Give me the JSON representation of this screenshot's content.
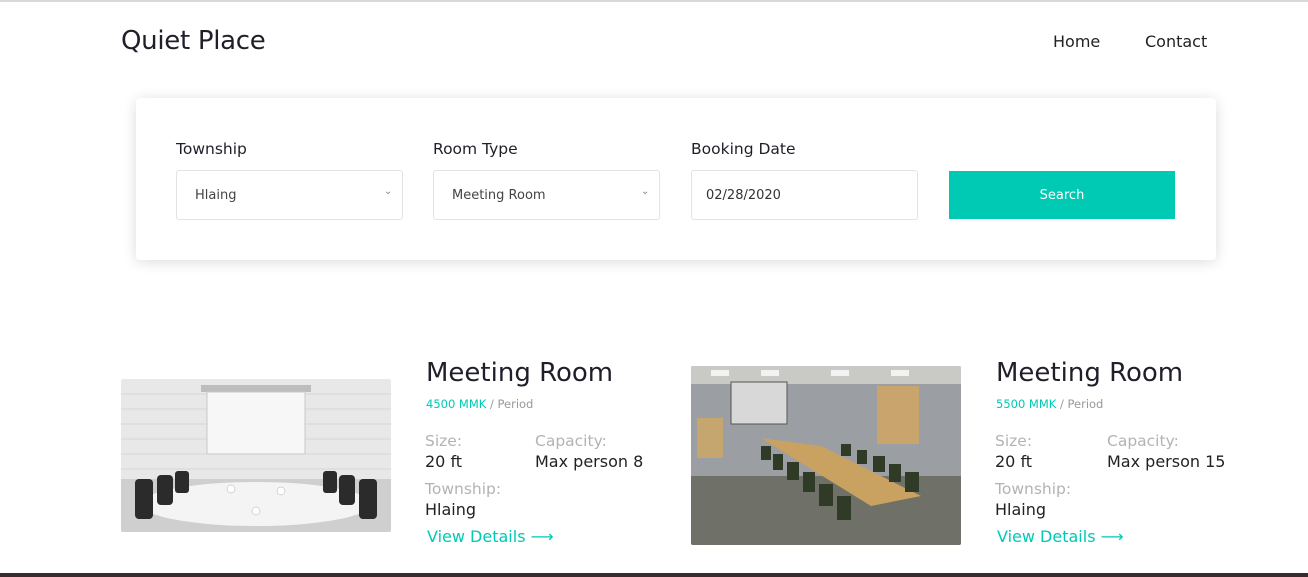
{
  "header": {
    "brand": "Quiet Place",
    "nav": [
      {
        "label": "Home"
      },
      {
        "label": "Contact"
      }
    ]
  },
  "search": {
    "township": {
      "label": "Township",
      "value": "Hlaing"
    },
    "room_type": {
      "label": "Room Type",
      "value": "Meeting Room"
    },
    "booking_date": {
      "label": "Booking Date",
      "value": "02/28/2020"
    },
    "button_label": "Search"
  },
  "rooms": [
    {
      "title": "Meeting Room",
      "price": "4500 MMK",
      "period": "/ Period",
      "size_label": "Size:",
      "size": "20 ft",
      "capacity_label": "Capacity:",
      "capacity": "Max person 8",
      "township_label": "Township:",
      "township": "Hlaing",
      "details_label": "View Details ⟶"
    },
    {
      "title": "Meeting Room",
      "price": "5500 MMK",
      "period": "/ Period",
      "size_label": "Size:",
      "size": "20 ft",
      "capacity_label": "Capacity:",
      "capacity": "Max person 15",
      "township_label": "Township:",
      "township": "Hlaing",
      "details_label": "View Details ⟶"
    }
  ],
  "colors": {
    "accent": "#00c9b4",
    "text": "#1f1f2a",
    "muted": "#b3b3b3"
  }
}
